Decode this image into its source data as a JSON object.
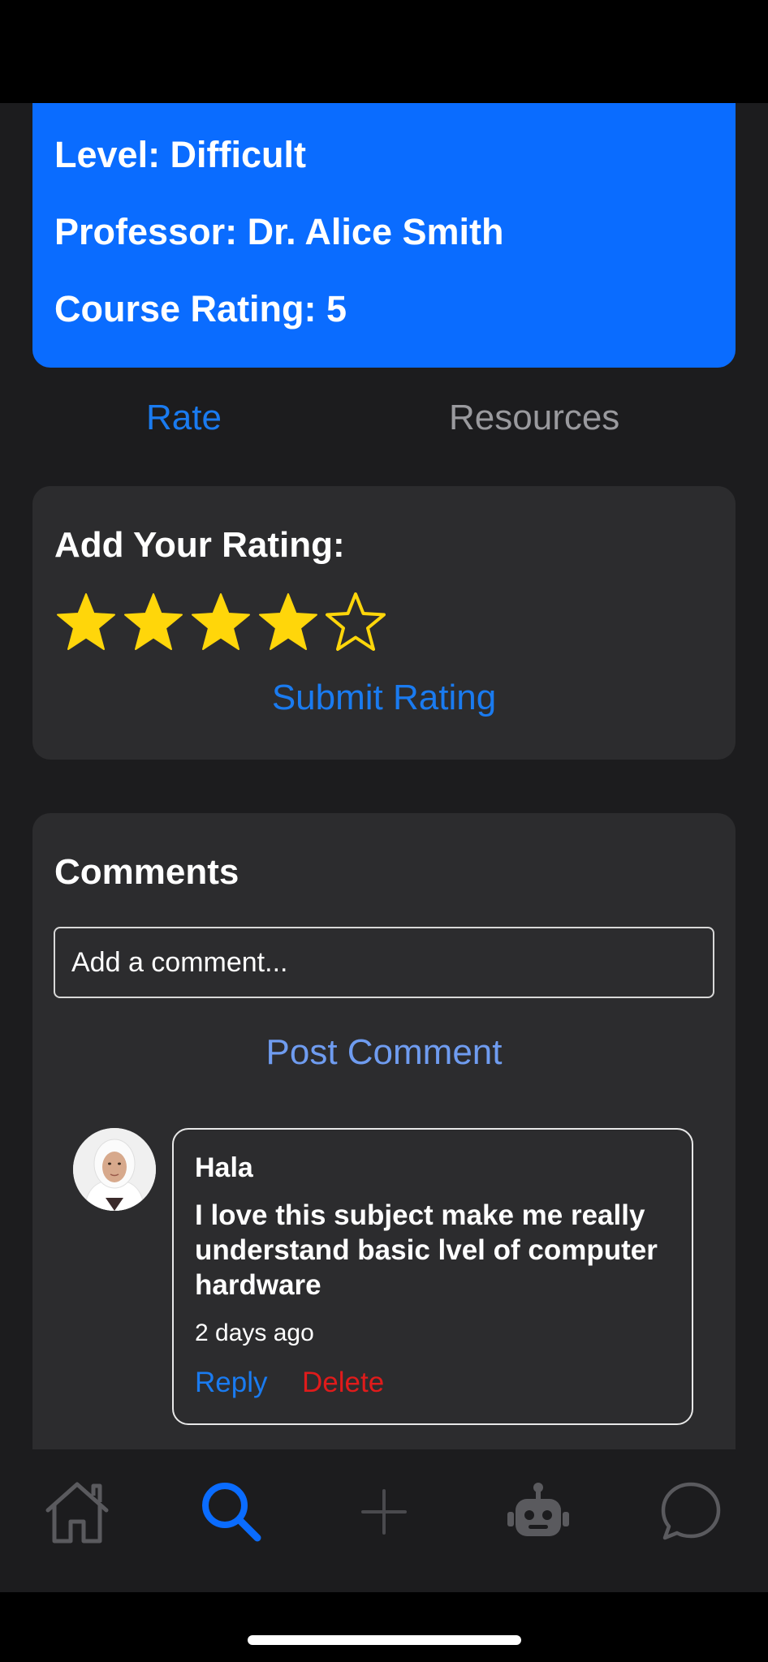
{
  "course": {
    "level": "Level: Difficult",
    "professor": "Professor: Dr. Alice Smith",
    "rating": "Course Rating: 5"
  },
  "tabs": [
    {
      "label": "Rate",
      "active": true
    },
    {
      "label": "Resources",
      "active": false
    }
  ],
  "rating_form": {
    "title": "Add Your Rating:",
    "selected_stars": 4,
    "max_stars": 5,
    "submit_label": "Submit Rating"
  },
  "comments": {
    "title": "Comments",
    "input_placeholder": "Add a comment...",
    "post_label": "Post Comment",
    "items": [
      {
        "author": "Hala",
        "text": "I love this subject make me really understand basic lvel of computer hardware",
        "time": "2 days ago",
        "reply_label": "Reply",
        "delete_label": "Delete"
      }
    ]
  },
  "bottom_nav": [
    {
      "icon": "home-icon",
      "active": false
    },
    {
      "icon": "search-icon",
      "active": true
    },
    {
      "icon": "plus-icon",
      "active": false
    },
    {
      "icon": "robot-icon",
      "active": false
    },
    {
      "icon": "chat-bubble-icon",
      "active": false
    }
  ],
  "colors": {
    "accent": "#0a6cff",
    "link": "#1a7bf0",
    "danger": "#e01b1b",
    "star": "#ffd60a",
    "card_bg": "#2c2c2e",
    "page_bg": "#1c1c1e"
  }
}
